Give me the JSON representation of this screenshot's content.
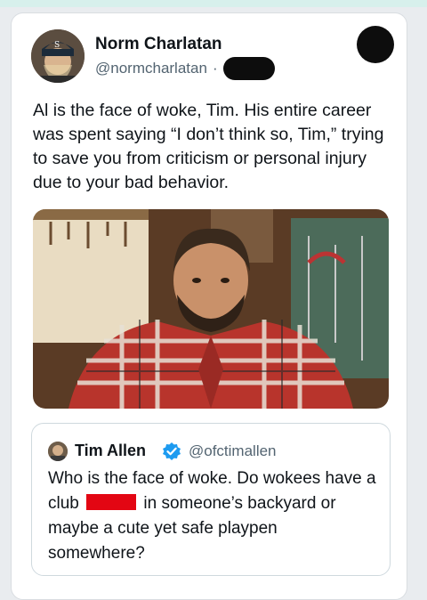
{
  "tweet": {
    "author_name": "Norm Charlatan",
    "author_handle": "@normcharlatan",
    "separator": "·",
    "text": "Al is the face of woke, Tim. His entire career was spent saying “I don’t think so, Tim,” trying to save you from criticism or personal injury due to your bad behavior."
  },
  "quoted_tweet": {
    "author_name": "Tim Allen",
    "author_handle": "@ofctimallen",
    "text_before": "Who is the face of woke. Do wokees have a club",
    "text_after": "in someone’s backyard or maybe a cute yet safe playpen somewhere?"
  },
  "icons": {
    "verified": "verified-badge-icon",
    "avatar": "avatar",
    "media": "photo"
  },
  "colors": {
    "verified_blue": "#1d9bf0",
    "redaction_red": "#e30613",
    "redaction_black": "#0d0d0d",
    "secondary_text": "#536471"
  }
}
